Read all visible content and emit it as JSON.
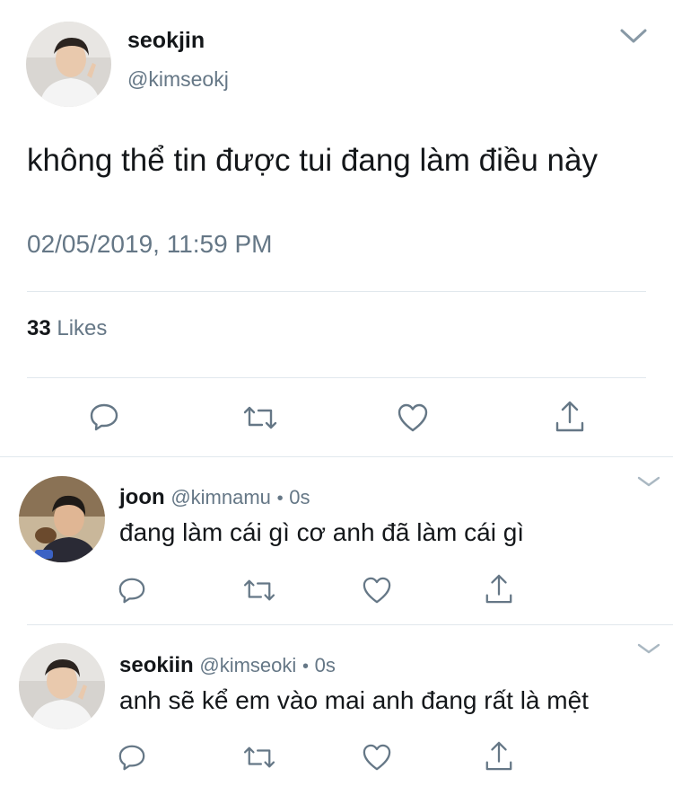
{
  "main_tweet": {
    "display_name": "seokjin",
    "handle": "@kimseokj",
    "text": "không thể tin được tui đang làm điều này",
    "timestamp": "02/05/2019, 11:59 PM",
    "likes_count": "33",
    "likes_label": "Likes",
    "avatar_icon": "avatar-photo",
    "menu_icon": "chevron-down-icon",
    "actions": [
      "reply-icon",
      "retweet-icon",
      "like-icon",
      "share-icon"
    ]
  },
  "replies": [
    {
      "display_name": "joon",
      "handle": "@kimnamu",
      "separator": "•",
      "time": "0s",
      "text": "đang làm cái gì cơ anh đã làm cái gì",
      "avatar_icon": "avatar-photo"
    },
    {
      "display_name": "seokiin",
      "handle": "@kimseoki",
      "separator": "•",
      "time": "0s",
      "text": "anh sẽ kể em vào mai anh đang rất là mệt",
      "avatar_icon": "avatar-photo"
    }
  ],
  "colors": {
    "text": "#14171a",
    "muted": "#657786",
    "divider": "#e1e8ed",
    "icon": "#657786"
  }
}
